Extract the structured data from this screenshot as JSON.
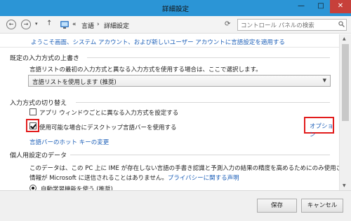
{
  "window": {
    "title": "詳細設定",
    "controls": {
      "minimize": "—",
      "maximize": "□",
      "close": "✕"
    }
  },
  "nav": {
    "back": "←",
    "forward": "→",
    "dropdown": "▾",
    "up": "↑",
    "breadcrumb": [
      "«",
      "言語",
      "›",
      "詳細設定"
    ],
    "refresh": "⟳",
    "search_placeholder": "コントロール パネルの検索"
  },
  "content": {
    "top_link": "ようこそ画面、システム アカウント、および新しいユーザー アカウントに言語設定を適用する",
    "override_input": {
      "title": "既定の入力方式の上書き",
      "description": "言語リストの最初の入力方式と異なる入力方式を使用する場合は、ここで選択します。",
      "dropdown_value": "言語リストを使用します (推奨)"
    },
    "switching": {
      "title": "入力方式の切り替え",
      "checkbox1": {
        "label": "アプリ ウィンドウごとに異なる入力方式を設定する",
        "checked": false
      },
      "checkbox2": {
        "label": "使用可能な場合にデスクトップ言語バーを使用する",
        "checked": true
      },
      "options_link": "オプション",
      "hotkey_link": "言語バーのホット キーの変更"
    },
    "personalization": {
      "title": "個人用設定のデータ",
      "line1": "このデータは、この PC 上に IME が存在しない言語の手書き認識と予測入力の結果の精度を高めるためにのみ使用されます。",
      "line2_prefix": "情報が Microsoft に送信されることはありません。",
      "privacy_link": "プライバシーに関する声明",
      "radio_label": "自動学習機能を使う (推奨)"
    }
  },
  "footer": {
    "save": "保存",
    "cancel": "キャンセル"
  },
  "colors": {
    "titlebar": "#2b95d6",
    "close_button": "#c7403a",
    "link": "#1c5fb8",
    "highlight": "#e21c1c"
  }
}
